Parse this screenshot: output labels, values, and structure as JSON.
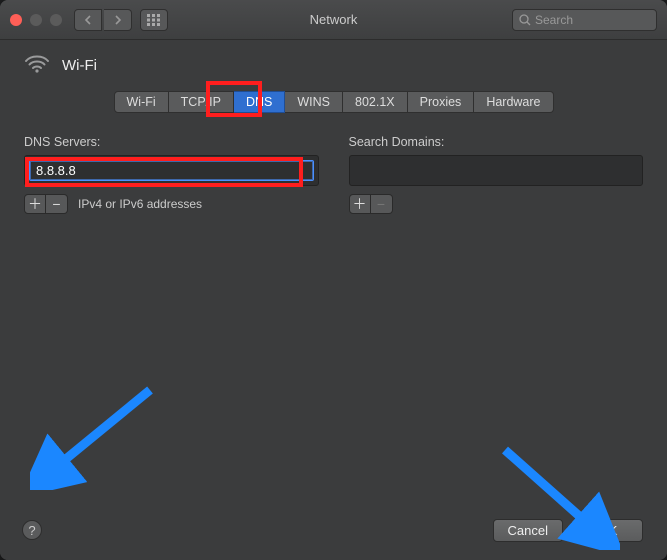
{
  "window": {
    "title": "Network"
  },
  "search": {
    "placeholder": "Search"
  },
  "header": {
    "connection_name": "Wi-Fi"
  },
  "tabs": [
    {
      "label": "Wi-Fi",
      "active": false
    },
    {
      "label": "TCP/IP",
      "active": false
    },
    {
      "label": "DNS",
      "active": true
    },
    {
      "label": "WINS",
      "active": false
    },
    {
      "label": "802.1X",
      "active": false
    },
    {
      "label": "Proxies",
      "active": false
    },
    {
      "label": "Hardware",
      "active": false
    }
  ],
  "dns_panel": {
    "servers_label": "DNS Servers:",
    "servers_entries": [
      "8.8.8.8"
    ],
    "servers_hint": "IPv4 or IPv6 addresses",
    "search_domains_label": "Search Domains:",
    "search_domains_entries": []
  },
  "buttons": {
    "cancel": "Cancel",
    "ok": "OK",
    "help": "?"
  },
  "icons": {
    "plus": "＋",
    "minus": "−"
  },
  "annotations": {
    "highlight_tab": "DNS",
    "highlight_entry": "8.8.8.8",
    "arrows": [
      "add-dns-server",
      "ok-button"
    ]
  }
}
